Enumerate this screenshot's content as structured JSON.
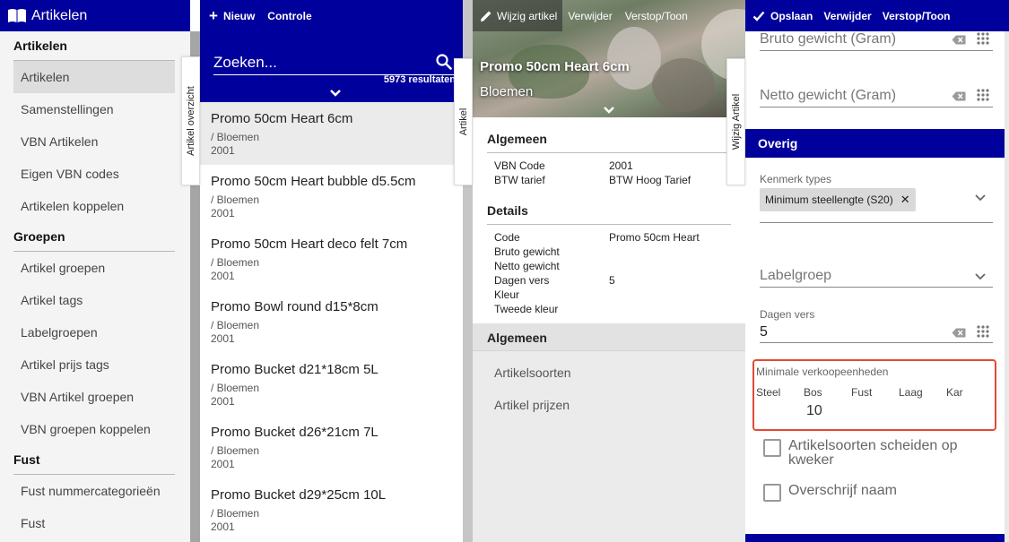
{
  "nav": {
    "title": "Artikelen",
    "sections": [
      {
        "label": "Artikelen",
        "items": [
          "Artikelen",
          "Samenstellingen",
          "VBN Artikelen",
          "Eigen VBN codes",
          "Artikelen koppelen"
        ]
      },
      {
        "label": "Groepen",
        "items": [
          "Artikel groepen",
          "Artikel tags",
          "Labelgroepen",
          "Artikel prijs tags",
          "VBN Artikel groepen",
          "VBN groepen koppelen"
        ]
      },
      {
        "label": "Fust",
        "items": [
          "Fust nummercategorieën",
          "Fust"
        ]
      }
    ],
    "active_item": "Artikelen"
  },
  "list": {
    "toolbar": {
      "new_label": "Nieuw",
      "check_label": "Controle"
    },
    "search_placeholder": "Zoeken...",
    "result_count": "5973 resultaten",
    "vtab_label": "Artikel overzicht",
    "items": [
      {
        "name": "Promo 50cm Heart 6cm",
        "category": "/ Bloemen",
        "code": "2001"
      },
      {
        "name": "Promo 50cm Heart bubble d5.5cm",
        "category": "/ Bloemen",
        "code": "2001"
      },
      {
        "name": "Promo 50cm Heart deco felt 7cm",
        "category": "/ Bloemen",
        "code": "2001"
      },
      {
        "name": "Promo Bowl round d15*8cm",
        "category": "/ Bloemen",
        "code": "2001"
      },
      {
        "name": "Promo Bucket d21*18cm 5L",
        "category": "/ Bloemen",
        "code": "2001"
      },
      {
        "name": "Promo Bucket d26*21cm 7L",
        "category": "/ Bloemen",
        "code": "2001"
      },
      {
        "name": "Promo Bucket d29*25cm 10L",
        "category": "/ Bloemen",
        "code": "2001"
      }
    ]
  },
  "detail": {
    "toolbar": {
      "edit_label": "Wijzig artikel",
      "delete_label": "Verwijder",
      "toggle_label": "Verstop/Toon"
    },
    "vtab_label": "Artikel",
    "title": "Promo 50cm Heart 6cm",
    "subtitle": "Bloemen",
    "general": {
      "heading": "Algemeen",
      "rows": [
        {
          "key": "VBN Code",
          "value": "2001"
        },
        {
          "key": "BTW tarief",
          "value": "BTW Hoog Tarief"
        }
      ]
    },
    "details": {
      "heading": "Details",
      "rows": [
        {
          "key": "Code",
          "value": "Promo 50cm Heart"
        },
        {
          "key": "Bruto gewicht",
          "value": ""
        },
        {
          "key": "Netto gewicht",
          "value": ""
        },
        {
          "key": "Dagen vers",
          "value": "5"
        },
        {
          "key": "Kleur",
          "value": ""
        },
        {
          "key": "Tweede kleur",
          "value": ""
        }
      ]
    },
    "general2": {
      "heading": "Algemeen",
      "links": [
        "Artikelsoorten",
        "Artikel prijzen"
      ]
    }
  },
  "form": {
    "toolbar": {
      "save_label": "Opslaan",
      "delete_label": "Verwijder",
      "toggle_label": "Verstop/Toon"
    },
    "vtab_label": "Wijzig Artikel",
    "bruto_label": "Bruto gewicht (Gram)",
    "netto_label": "Netto gewicht (Gram)",
    "overig_label": "Overig",
    "kenmerk_label": "Kenmerk types",
    "kenmerk_chip": "Minimum steellengte (S20)",
    "labelgroep_label": "Labelgroep",
    "dagen_vers_label": "Dagen vers",
    "dagen_vers_value": "5",
    "min_units_label": "Minimale verkoopeenheden",
    "units": [
      "Steel",
      "Bos",
      "Fust",
      "Laag",
      "Kar"
    ],
    "min_units_value": "10",
    "checkbox1_label": "Artikelsoorten scheiden op kweker",
    "checkbox2_label": "Overschrijf naam"
  },
  "colors": {
    "primary": "#00009c",
    "highlight": "#e14a34"
  }
}
